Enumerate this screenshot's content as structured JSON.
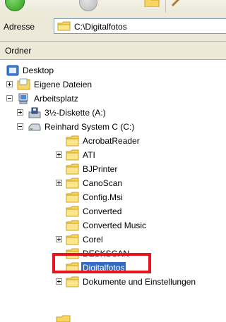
{
  "address_bar": {
    "label": "Adresse",
    "path": "C:\\Digitalfotos",
    "icon": "folder-icon"
  },
  "folder_pane": {
    "header": "Ordner"
  },
  "tree": {
    "desktop": {
      "label": "Desktop",
      "icon": "desktop-icon"
    },
    "eigene_dateien": {
      "label": "Eigene Dateien",
      "icon": "documents-folder-icon",
      "expander": "plus"
    },
    "arbeitsplatz": {
      "label": "Arbeitsplatz",
      "icon": "my-computer-icon",
      "expander": "minus"
    },
    "diskette": {
      "label": "3½-Diskette (A:)",
      "icon": "floppy-drive-icon",
      "expander": "plus"
    },
    "drive_c": {
      "label": "Reinhard System C (C:)",
      "icon": "hard-drive-icon",
      "expander": "minus"
    },
    "folders": [
      {
        "label": "AcrobatReader",
        "expander": "none"
      },
      {
        "label": "ATI",
        "expander": "plus"
      },
      {
        "label": "BJPrinter",
        "expander": "none"
      },
      {
        "label": "CanoScan",
        "expander": "plus"
      },
      {
        "label": "Config.Msi",
        "expander": "none"
      },
      {
        "label": "Converted",
        "expander": "none"
      },
      {
        "label": "Converted Music",
        "expander": "none"
      },
      {
        "label": "Corel",
        "expander": "plus"
      },
      {
        "label": "DESKSCAN",
        "expander": "none"
      },
      {
        "label": "Digitalfotos",
        "expander": "none",
        "selected": true
      },
      {
        "label": "Dokumente und Einstellungen",
        "expander": "plus"
      }
    ]
  },
  "colors": {
    "selection": "#316ac5",
    "highlight_box": "#e8141c",
    "folder": "#f7d560"
  }
}
